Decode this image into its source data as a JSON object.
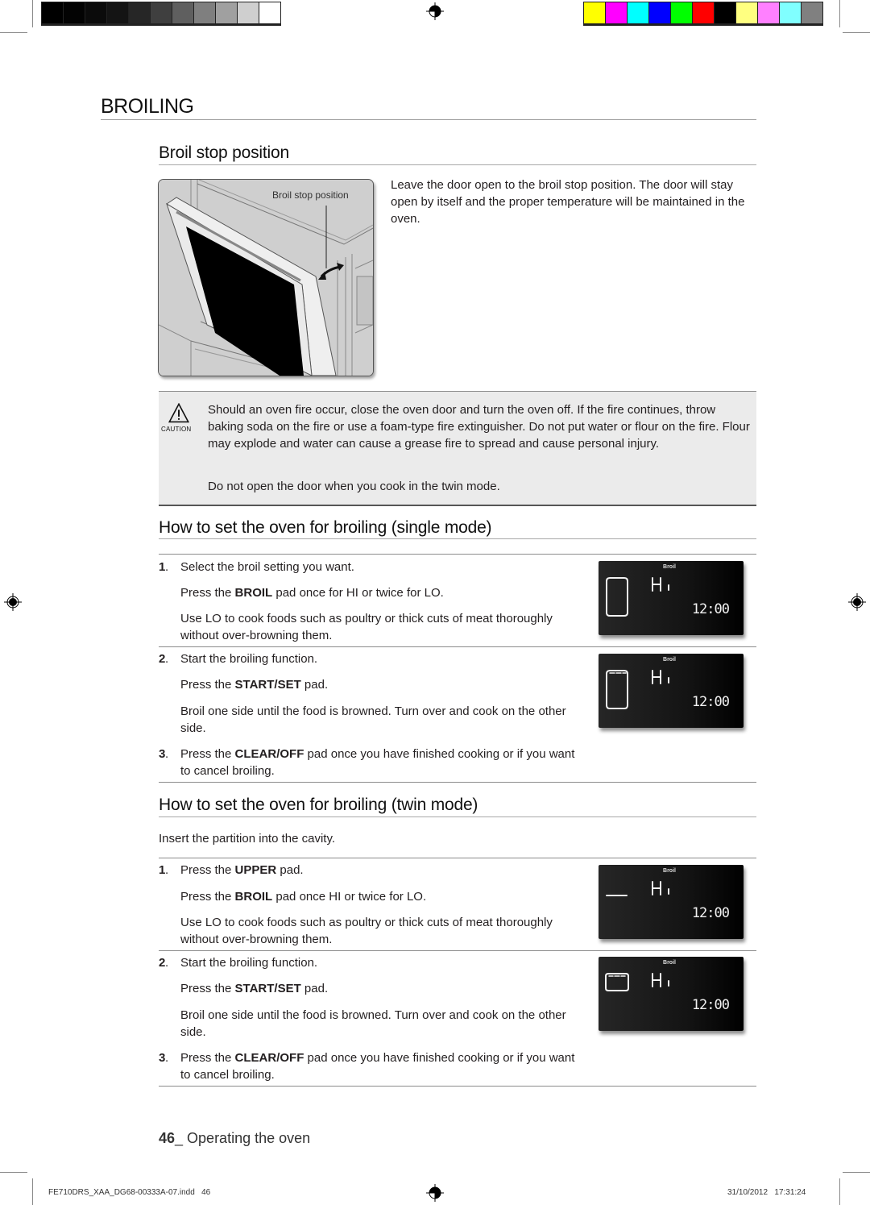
{
  "print_marks": {
    "grayscale_swatches": [
      "#000000",
      "#030303",
      "#0b0b0b",
      "#141414",
      "#262626",
      "#3f3f3f",
      "#5f5f5f",
      "#7f7f7f",
      "#a0a0a0",
      "#cfcfcf",
      "#ffffff"
    ],
    "color_swatches": [
      "#ffff00",
      "#ff00ff",
      "#00ffff",
      "#0000ff",
      "#00ff00",
      "#ff0000",
      "#000000",
      "#ffff80",
      "#ff80ff",
      "#80ffff",
      "#808080"
    ]
  },
  "page": {
    "title": "BROILING",
    "sections": {
      "stop_position": {
        "heading": "Broil stop position",
        "illustration_label": "Broil stop position",
        "description": "Leave the door open to the broil stop position. The door will stay open by itself and the proper temperature will be maintained in the oven."
      },
      "caution": {
        "icon_label": "CAUTION",
        "paragraph1": "Should an oven fire occur, close the oven door and turn the oven off. If the fire continues, throw baking soda on the fire or use a foam-type fire extinguisher. Do not put water or flour on the fire. Flour may explode and water can cause a grease fire to spread and cause personal injury.",
        "paragraph2": "Do not open the door when you cook in the twin mode."
      },
      "single_mode": {
        "heading": "How to set the oven for broiling (single mode)",
        "steps": [
          {
            "num": "1",
            "title": "Select the broil setting you want.",
            "line_pre": "Press the ",
            "line_bold": "BROIL",
            "line_post": " pad once for HI or twice for LO.",
            "note": "Use LO to cook foods such as poultry or thick cuts of meat thoroughly without over-browning them."
          },
          {
            "num": "2",
            "title": "Start the broiling function.",
            "line_pre": "Press the ",
            "line_bold": "START/SET",
            "line_post": " pad.",
            "note": "Broil one side until the food is browned. Turn over and cook on the other side."
          },
          {
            "num": "3",
            "line_pre": "Press the ",
            "line_bold": "CLEAR/OFF",
            "line_post": " pad once you have finished cooking or if you want to cancel broiling."
          }
        ]
      },
      "twin_mode": {
        "heading": "How to set the oven for broiling (twin mode)",
        "intro": "Insert the partition into the cavity.",
        "steps": [
          {
            "num": "1",
            "line_pre": "Press the ",
            "line_bold": "UPPER",
            "line_post": " pad.",
            "sub_pre": "Press the ",
            "sub_bold": "BROIL",
            "sub_post": " pad once HI or twice for LO.",
            "note": "Use LO to cook foods such as poultry or thick cuts of meat thoroughly without over-browning them."
          },
          {
            "num": "2",
            "title": "Start the broiling function.",
            "line_pre": "Press the ",
            "line_bold": "START/SET",
            "line_post": " pad.",
            "note": "Broil one side until the food is browned. Turn over and cook on the other side."
          },
          {
            "num": "3",
            "line_pre": "Press the ",
            "line_bold": "CLEAR/OFF",
            "line_post": " pad once you have finished cooking or if you want to cancel broiling."
          }
        ]
      }
    },
    "displays": [
      {
        "mode_label": "Broil",
        "setting": "Hi",
        "clock": "12:00",
        "indicator": "single-oven"
      },
      {
        "mode_label": "Broil",
        "setting": "Hi",
        "clock": "12:00",
        "indicator": "single-oven-heating"
      },
      {
        "mode_label": "Broil",
        "setting": "Hi",
        "clock": "12:00",
        "indicator": "upper-partition"
      },
      {
        "mode_label": "Broil",
        "setting": "Hi",
        "clock": "12:00",
        "indicator": "upper-oven-heating"
      }
    ]
  },
  "footer": {
    "page_number": "46",
    "section": "_ Operating the oven",
    "slug_file": "FE710DRS_XAA_DG68-00333A-07.indd   46",
    "slug_date": "31/10/2012   17:31:24"
  }
}
